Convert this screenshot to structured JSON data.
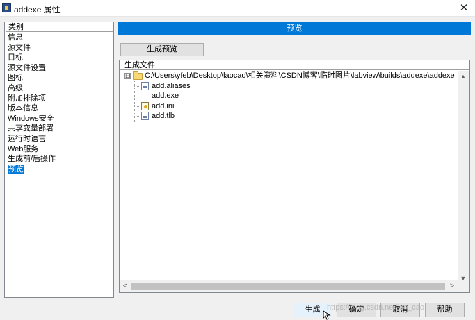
{
  "window": {
    "title": "addexe 属性",
    "close_glyph": "✕"
  },
  "sidebar": {
    "header": "类别",
    "items": [
      {
        "label": "信息"
      },
      {
        "label": "源文件"
      },
      {
        "label": "目标"
      },
      {
        "label": "源文件设置"
      },
      {
        "label": "图标"
      },
      {
        "label": "高级"
      },
      {
        "label": "附加排除项"
      },
      {
        "label": "版本信息"
      },
      {
        "label": "Windows安全"
      },
      {
        "label": "共享变量部署"
      },
      {
        "label": "运行时语言"
      },
      {
        "label": "Web服务"
      },
      {
        "label": "生成前/后操作"
      },
      {
        "label": "预览"
      }
    ],
    "selected_index": 13
  },
  "panel": {
    "header": "预览",
    "generate_preview_button": "生成预览",
    "files_header": "生成文件",
    "tree": {
      "root": {
        "label": "C:\\Users\\yfeb\\Desktop\\laocao\\相关资料\\CSDN博客\\临时图片\\labview\\builds\\addexe\\addexe",
        "icon": "folder-icon",
        "expander": "⊟"
      },
      "children": [
        {
          "label": "add.aliases",
          "icon": "document-icon"
        },
        {
          "label": "add.exe",
          "icon": "none"
        },
        {
          "label": "add.ini",
          "icon": "config-file-icon"
        },
        {
          "label": "add.tlb",
          "icon": "document-icon"
        }
      ]
    }
  },
  "scroll": {
    "up": "▲",
    "down": "▼",
    "left": "<",
    "right": ">"
  },
  "footer": {
    "build": "生成",
    "ok": "确定",
    "cancel": "取消",
    "help": "帮助"
  },
  "watermark": "https://blog.csdn.net/lao_cao",
  "colors": {
    "accent": "#0078d7"
  }
}
